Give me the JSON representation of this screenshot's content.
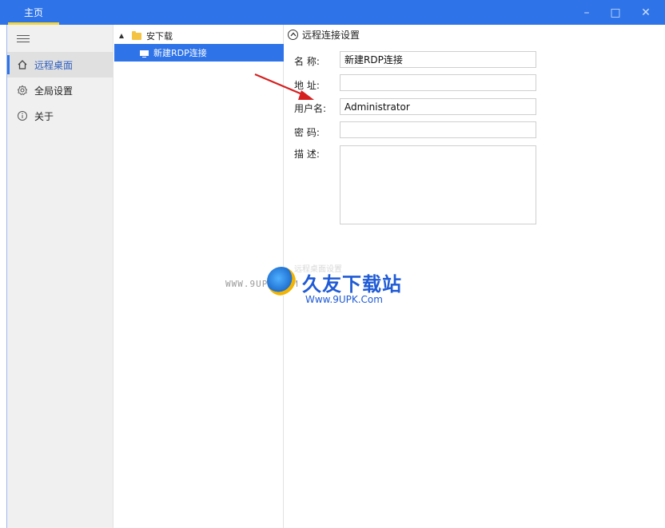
{
  "titlebar": {
    "tab": "主页",
    "minimize": "–",
    "maximize": "□",
    "close": "✕"
  },
  "sidebar": {
    "items": [
      {
        "label": "远程桌面",
        "icon": "home-icon",
        "active": true
      },
      {
        "label": "全局设置",
        "icon": "gear-icon",
        "active": false
      },
      {
        "label": "关于",
        "icon": "info-icon",
        "active": false
      }
    ]
  },
  "tree": {
    "group": "安下载",
    "item": "新建RDP连接"
  },
  "panel": {
    "section_title": "远程连接设置",
    "fields": {
      "name_label": "名  称:",
      "name_value": "新建RDP连接",
      "address_label": "地  址:",
      "address_value": "",
      "user_label": "用户名:",
      "user_value": "Administrator",
      "password_label": "密  码:",
      "password_value": "",
      "desc_label": "描  述:",
      "desc_value": ""
    }
  },
  "watermark": {
    "small": "WWW.9UPK.COM",
    "main": "久友下载站",
    "sub": "Www.9UPK.Com",
    "faint": "远程桌面设置"
  },
  "colors": {
    "accent": "#2e73e8",
    "tab_underline": "#f2d53c",
    "arrow": "#d62020"
  }
}
